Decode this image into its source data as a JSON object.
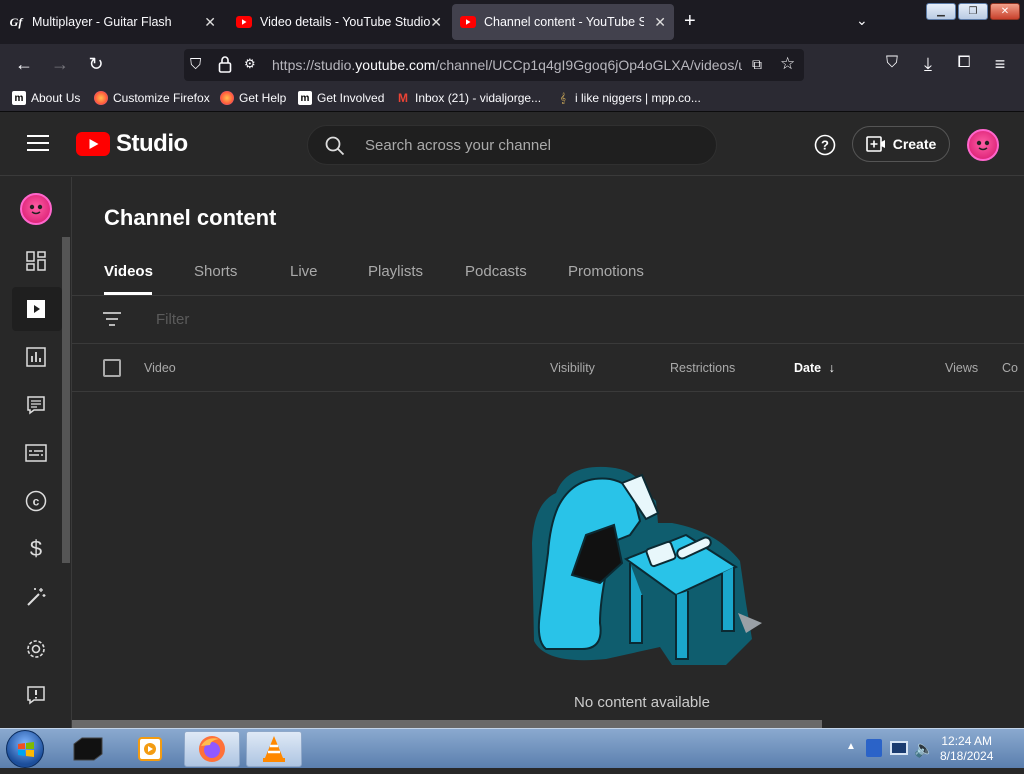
{
  "browser": {
    "tabs": [
      {
        "title": "Multiplayer - Guitar Flash",
        "icon": "guitar-flash-icon"
      },
      {
        "title": "Video details - YouTube Studio",
        "icon": "youtube-icon"
      },
      {
        "title": "Channel content - YouTube Studio",
        "icon": "youtube-icon",
        "active": true
      }
    ],
    "url_prefix": "https://studio.",
    "url_domain": "youtube.com",
    "url_rest": "/channel/UCCp1q4gI9Ggoq6jOp4oGLXA/videos/u",
    "bookmarks": [
      "About Us",
      "Customize Firefox",
      "Get Help",
      "Get Involved",
      "Inbox (21) - vidaljorge...",
      "i like niggers | mpp.co..."
    ]
  },
  "header": {
    "logo_text": "Studio",
    "search_placeholder": "Search across your channel",
    "create_label": "Create"
  },
  "main": {
    "title": "Channel content",
    "tabs": [
      "Videos",
      "Shorts",
      "Live",
      "Playlists",
      "Podcasts",
      "Promotions"
    ],
    "active_tab": "Videos",
    "filter_placeholder": "Filter",
    "columns": [
      "Video",
      "Visibility",
      "Restrictions",
      "Date",
      "Views",
      "Co"
    ],
    "sorted_column": "Date",
    "empty_message": "No content available"
  },
  "taskbar": {
    "time": "12:24 AM",
    "date": "8/18/2024"
  },
  "colors": {
    "bg": "#282828",
    "youtube_red": "#ff0000",
    "accent_teal": "#27c1e6"
  }
}
